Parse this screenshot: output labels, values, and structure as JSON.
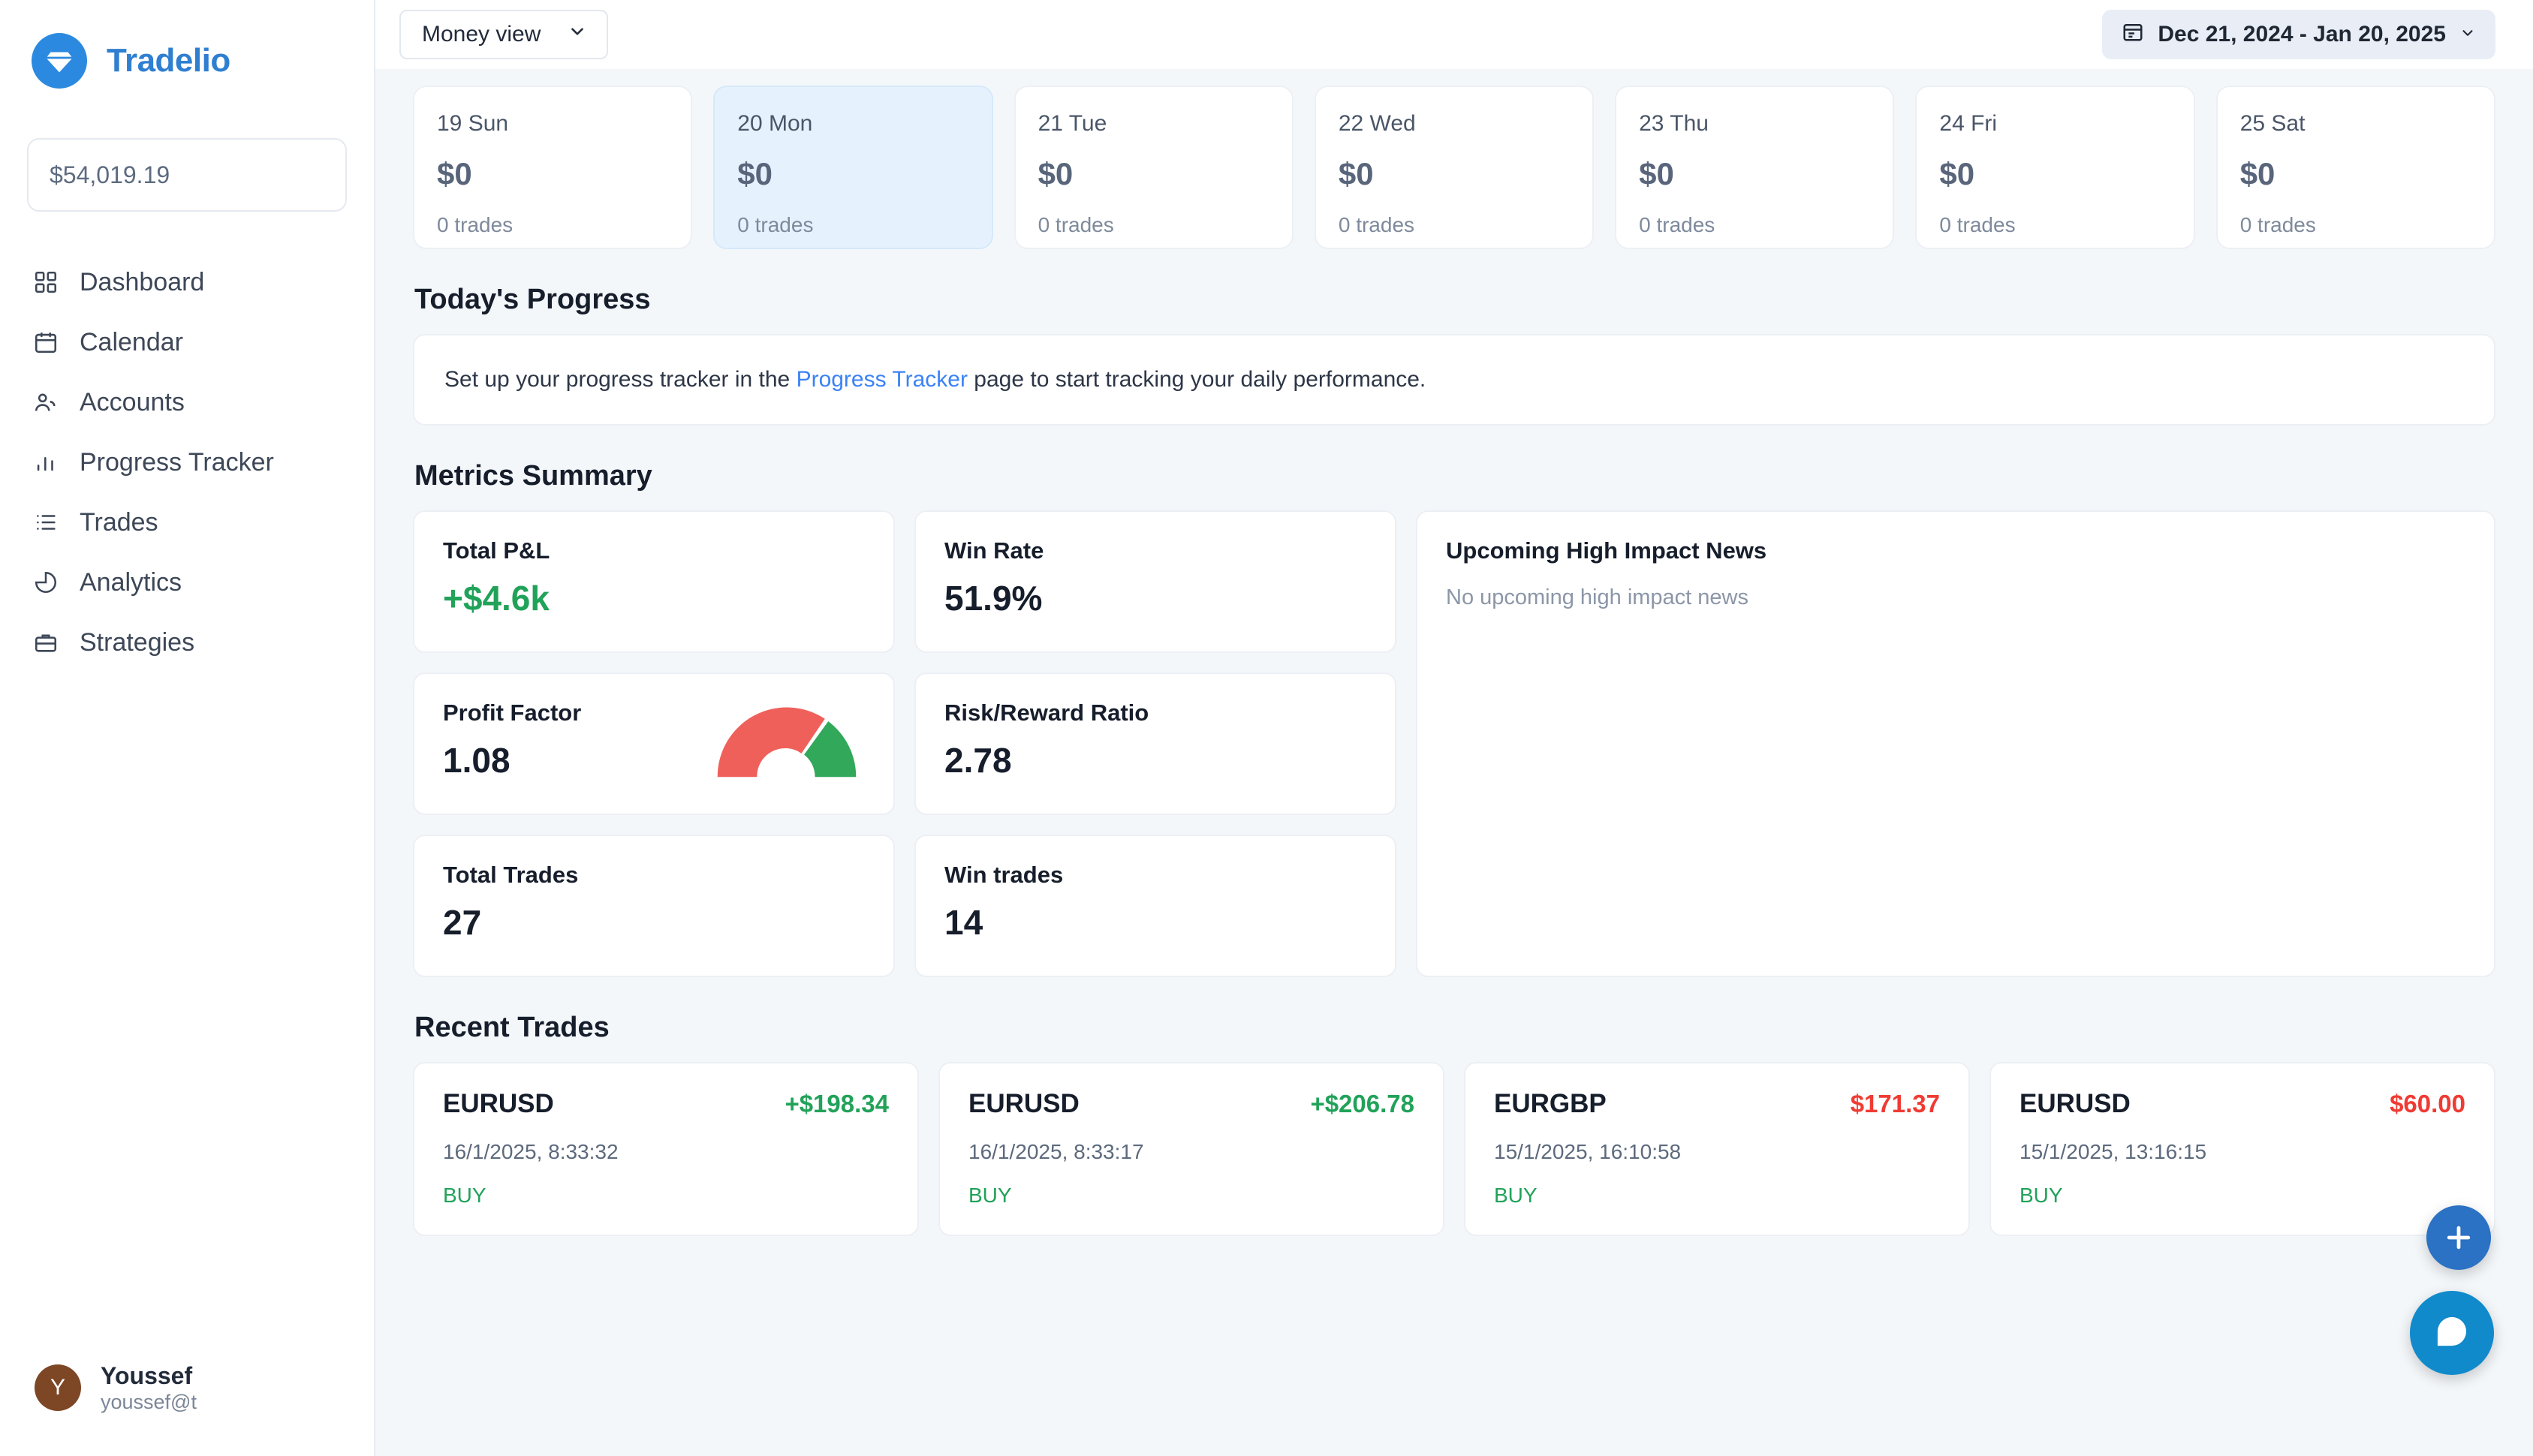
{
  "brand": {
    "name": "Tradelio",
    "logo_icon": "diamond-logo-icon",
    "accent": "#2f7fd1"
  },
  "sidebar": {
    "balance": "$54,019.19",
    "items": [
      {
        "label": "Dashboard",
        "icon": "grid-icon"
      },
      {
        "label": "Calendar",
        "icon": "calendar-icon"
      },
      {
        "label": "Accounts",
        "icon": "users-icon"
      },
      {
        "label": "Progress Tracker",
        "icon": "bar-chart-icon"
      },
      {
        "label": "Trades",
        "icon": "list-icon"
      },
      {
        "label": "Analytics",
        "icon": "pie-chart-icon"
      },
      {
        "label": "Strategies",
        "icon": "briefcase-icon"
      }
    ],
    "user": {
      "initial": "Y",
      "name": "Youssef",
      "email": "youssef@t",
      "avatar_color": "#7d4726"
    }
  },
  "topbar": {
    "view_select": {
      "value": "Money view",
      "chevron_icon": "chevron-down-icon"
    },
    "date_range": {
      "value": "Dec 21, 2024 - Jan 20, 2025",
      "calendar_icon": "calendar-icon",
      "chevron_icon": "chevron-down-icon"
    }
  },
  "days": [
    {
      "label": "19 Sun",
      "amount": "$0",
      "trades": "0 trades",
      "active": false
    },
    {
      "label": "20 Mon",
      "amount": "$0",
      "trades": "0 trades",
      "active": true
    },
    {
      "label": "21 Tue",
      "amount": "$0",
      "trades": "0 trades",
      "active": false
    },
    {
      "label": "22 Wed",
      "amount": "$0",
      "trades": "0 trades",
      "active": false
    },
    {
      "label": "23 Thu",
      "amount": "$0",
      "trades": "0 trades",
      "active": false
    },
    {
      "label": "24 Fri",
      "amount": "$0",
      "trades": "0 trades",
      "active": false
    },
    {
      "label": "25 Sat",
      "amount": "$0",
      "trades": "0 trades",
      "active": false
    }
  ],
  "progress": {
    "heading": "Today's Progress",
    "text_before": "Set up your progress tracker in the ",
    "link": "Progress Tracker",
    "text_after": " page to start tracking your daily performance."
  },
  "metrics": {
    "heading": "Metrics Summary",
    "cards": [
      {
        "label": "Total P&L",
        "value": "+$4.6k",
        "positive": true
      },
      {
        "label": "Win Rate",
        "value": "51.9%",
        "positive": false
      },
      {
        "label": "Profit Factor",
        "value": "1.08",
        "positive": false,
        "gauge": true
      },
      {
        "label": "Risk/Reward Ratio",
        "value": "2.78",
        "positive": false
      },
      {
        "label": "Total Trades",
        "value": "27",
        "positive": false
      },
      {
        "label": "Win trades",
        "value": "14",
        "positive": false
      }
    ],
    "gauge": {
      "red_color": "#f0605a",
      "green_color": "#31a85a",
      "red_fraction": 0.7,
      "green_fraction": 0.3
    }
  },
  "news": {
    "title": "Upcoming High Impact News",
    "empty": "No upcoming high impact news"
  },
  "recent_trades": {
    "heading": "Recent Trades",
    "items": [
      {
        "symbol": "EURUSD",
        "pl": "+$198.34",
        "positive": true,
        "time": "16/1/2025, 8:33:32",
        "side": "BUY"
      },
      {
        "symbol": "EURUSD",
        "pl": "+$206.78",
        "positive": true,
        "time": "16/1/2025, 8:33:17",
        "side": "BUY"
      },
      {
        "symbol": "EURGBP",
        "pl": "$171.37",
        "positive": false,
        "time": "15/1/2025, 16:10:58",
        "side": "BUY"
      },
      {
        "symbol": "EURUSD",
        "pl": "$60.00",
        "positive": false,
        "time": "15/1/2025, 13:16:15",
        "side": "BUY"
      }
    ]
  },
  "fabs": {
    "add_label": "+",
    "add_icon": "plus-icon",
    "chat_icon": "chat-bubble-icon"
  }
}
